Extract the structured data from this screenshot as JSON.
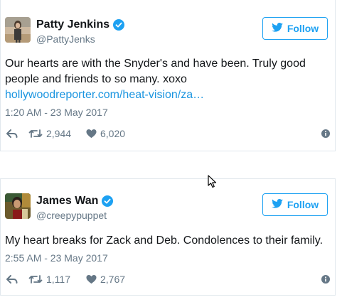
{
  "colors": {
    "accent": "#1da1f2",
    "link": "#1b95e0",
    "muted": "#657786",
    "text": "#14171a",
    "border": "#e1e8ed"
  },
  "tweets": [
    {
      "display_name": "Patty Jenkins",
      "handle": "@PattyJenks",
      "follow_label": "Follow",
      "text": "Our hearts are with the Snyder's and have been. Truly good people and friends to so many. xoxo",
      "link": "hollywoodreporter.com/heat-vision/za…",
      "timestamp": "1:20 AM - 23 May 2017",
      "retweets": "2,944",
      "likes": "6,020",
      "icons": [
        "verified-badge-icon",
        "twitter-bird-icon",
        "reply-icon",
        "retweet-icon",
        "heart-icon",
        "info-icon"
      ]
    },
    {
      "display_name": "James Wan",
      "handle": "@creepypuppet",
      "follow_label": "Follow",
      "text": "My heart breaks for Zack and Deb. Condolences to their family.",
      "timestamp": "2:55 AM - 23 May 2017",
      "retweets": "1,117",
      "likes": "2,767",
      "icons": [
        "verified-badge-icon",
        "twitter-bird-icon",
        "reply-icon",
        "retweet-icon",
        "heart-icon",
        "info-icon"
      ]
    }
  ]
}
